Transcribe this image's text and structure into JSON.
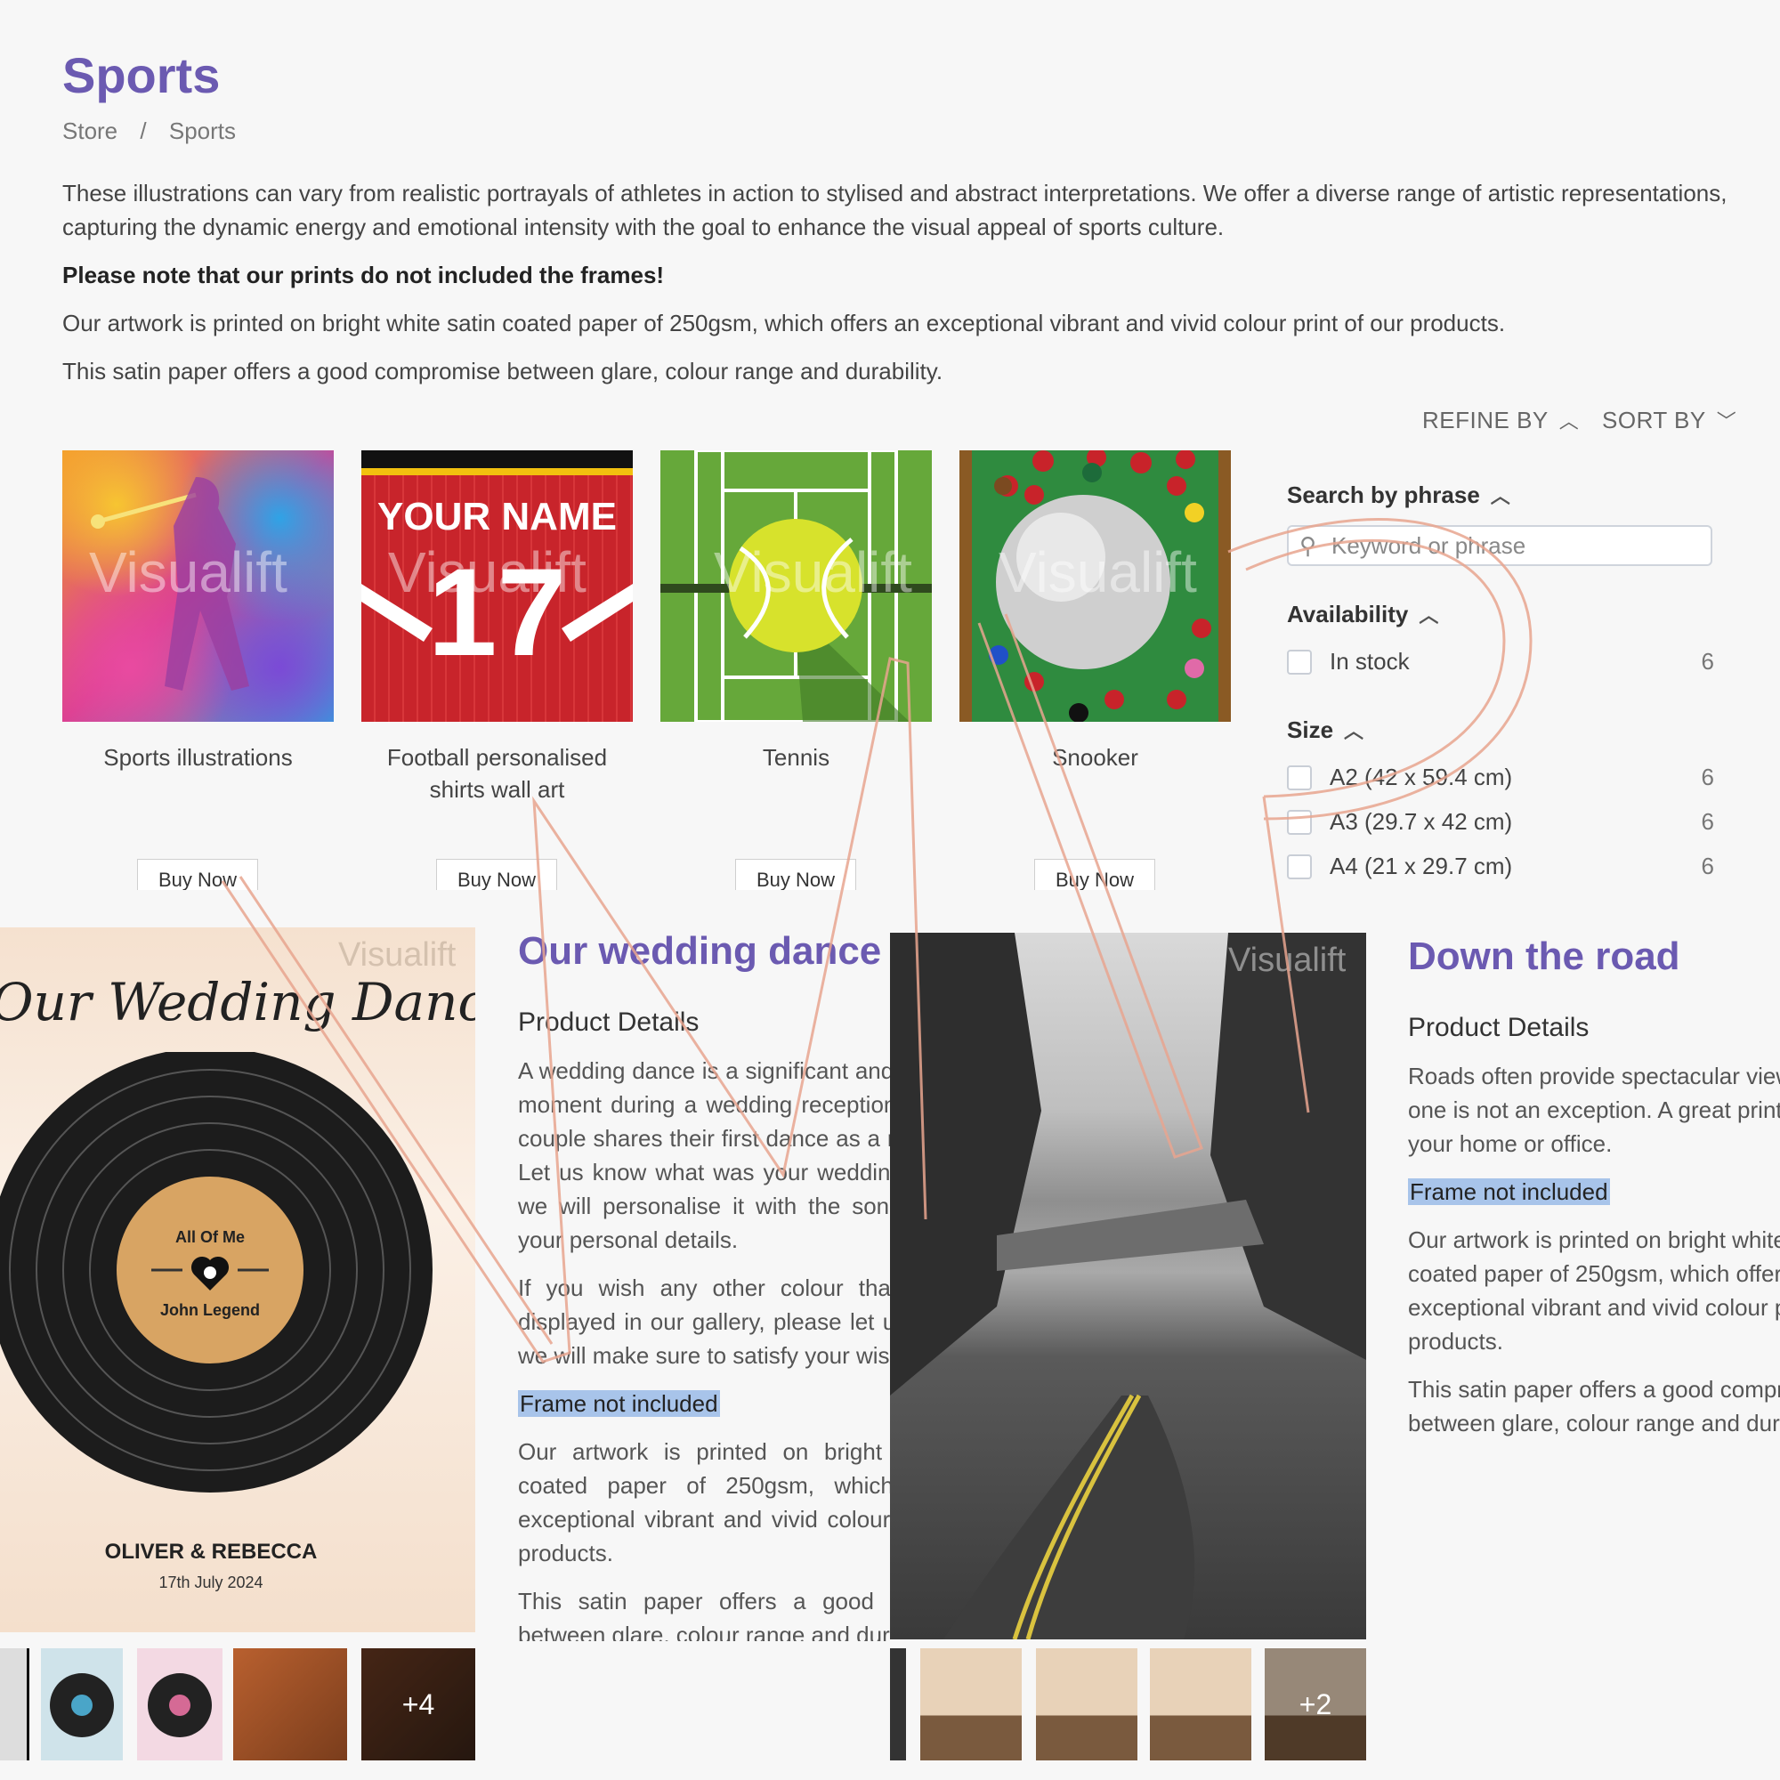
{
  "header": {
    "title": "Sports",
    "breadcrumb": [
      "Store",
      "/",
      "Sports"
    ]
  },
  "intro": {
    "p1": "These illustrations can vary from realistic portrayals of athletes in action to stylised and abstract interpretations. We offer a diverse range of artistic representations, capturing the dynamic energy and emotional intensity with the goal to enhance the visual appeal of sports culture.",
    "note": "Please note that our prints do not included the frames!",
    "p2": "Our artwork is printed on bright white satin coated paper of 250gsm, which offers an exceptional vibrant and vivid colour print of our products.",
    "p3": "This satin paper offers a good compromise between glare, colour range and durability."
  },
  "toolbar": {
    "refine_label": "REFINE BY",
    "sort_label": "SORT BY"
  },
  "products": [
    {
      "caption": "Sports illustrations",
      "button": "Buy Now"
    },
    {
      "caption": "Football personalised shirts wall art",
      "button": "Buy Now",
      "shirt_name": "YOUR NAME",
      "shirt_number": "17"
    },
    {
      "caption": "Tennis",
      "button": "Buy Now"
    },
    {
      "caption": "Snooker",
      "button": "Buy Now"
    }
  ],
  "watermark": "Visualift",
  "filters": {
    "search": {
      "heading": "Search by phrase",
      "placeholder": "Keyword or phrase"
    },
    "availability": {
      "heading": "Availability",
      "options": [
        {
          "label": "In stock",
          "count": "6"
        }
      ]
    },
    "size": {
      "heading": "Size",
      "options": [
        {
          "label": "A2 (42 x 59.4 cm)",
          "count": "6"
        },
        {
          "label": "A3 (29.7 x 42 cm)",
          "count": "6"
        },
        {
          "label": "A4 (21 x 29.7 cm)",
          "count": "6"
        }
      ]
    }
  },
  "wedding": {
    "poster_title": "Our Wedding Dance",
    "record_song": "All Of Me",
    "record_artist": "John Legend",
    "names": "OLIVER & REBECCA",
    "date": "17th July 2024",
    "title": "Our wedding dance",
    "subtitle": "Product Details",
    "p1": "A wedding dance is a significant and memorable moment during a wedding reception, where the couple shares their first dance as a married pair. Let us know what was your wedding song, and we will personalise it with the song lyrics and your personal details.",
    "p2": "If you wish any other colour than the ones displayed in our gallery, please let us know and we will make sure to satisfy your wishes.",
    "frame": "Frame not included",
    "p3": "Our artwork is printed on bright white satin coated paper of 250gsm, which offers an exceptional vibrant and vivid colour print of our products.",
    "p4": "This satin paper offers a good compromise between glare, colour range and durability.",
    "more_images": "+4"
  },
  "road": {
    "title": "Down the road",
    "subtitle": "Product Details",
    "p1": "Roads often provide spectacular views and this one is not an exception. A great print to decorate your home or office.",
    "frame": "Frame not included",
    "p2": "Our artwork is printed on bright white satin coated paper of 250gsm, which offers an exceptional vibrant and vivid colour print of our products.",
    "p3": "This satin paper offers a good compromise between glare, colour range and durability.",
    "more_images": "+2"
  },
  "colors": {
    "accent": "#6b5ab1",
    "highlight": "#a8c4ea",
    "overlay_stroke": "#e8a58f"
  }
}
